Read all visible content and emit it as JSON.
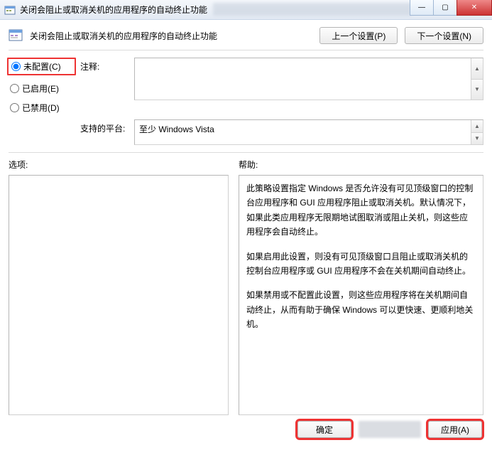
{
  "window": {
    "title": "关闭会阻止或取消关机的应用程序的自动终止功能",
    "controls": {
      "minimize": "—",
      "maximize": "▢",
      "close": "✕"
    }
  },
  "header": {
    "policy_title": "关闭会阻止或取消关机的应用程序的自动终止功能"
  },
  "nav": {
    "prev": "上一个设置(P)",
    "next": "下一个设置(N)"
  },
  "radios": {
    "not_configured": "未配置(C)",
    "enabled": "已启用(E)",
    "disabled": "已禁用(D)",
    "selected": "not_configured"
  },
  "fields": {
    "comment_label": "注释:",
    "comment_value": "",
    "platform_label": "支持的平台:",
    "platform_value": "至少 Windows Vista"
  },
  "panes": {
    "options_label": "选项:",
    "help_label": "帮助:",
    "help_p1": "此策略设置指定 Windows 是否允许没有可见顶级窗口的控制台应用程序和 GUI 应用程序阻止或取消关机。默认情况下，如果此类应用程序无限期地试图取消或阻止关机，则这些应用程序会自动终止。",
    "help_p2": "如果启用此设置，则没有可见顶级窗口且阻止或取消关机的控制台应用程序或 GUI 应用程序不会在关机期间自动终止。",
    "help_p3": "如果禁用或不配置此设置，则这些应用程序将在关机期间自动终止，从而有助于确保 Windows 可以更快速、更顺利地关机。"
  },
  "buttons": {
    "ok": "确定",
    "apply": "应用(A)"
  }
}
